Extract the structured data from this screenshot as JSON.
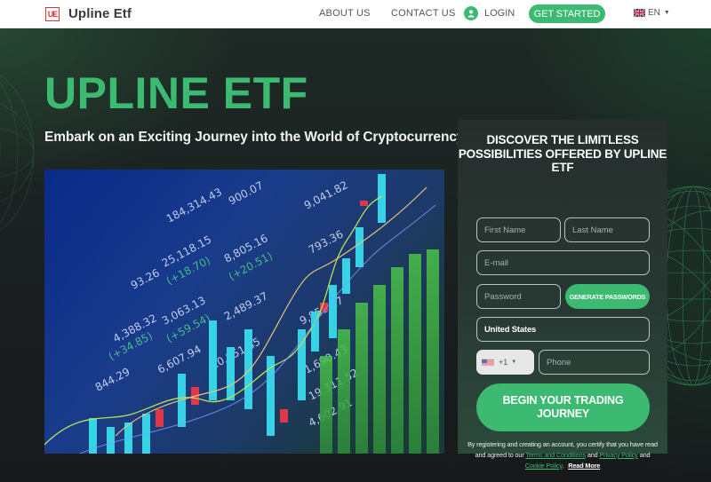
{
  "header": {
    "logo_mark": "UE",
    "logo_text": "Upline Etf",
    "nav": [
      {
        "label": "ABOUT US"
      },
      {
        "label": "CONTACT US"
      }
    ],
    "login_label": "LOGIN",
    "get_started_label": "GET STARTED",
    "language": "EN"
  },
  "hero": {
    "title": "UPLINE ETF",
    "subtitle": "Embark on an Exciting Journey into the World of Cryptocurrency",
    "image_alt": "Stock market ticker board with candlestick chart",
    "image_ticker_values": [
      "184,314.43",
      "900.07",
      "25,118.15",
      "8,805.16",
      "(+20.51)",
      "(+18.70)",
      "3,063.13",
      "(+59.54)",
      "2,489.37",
      "4,388.32",
      "(+34.85)",
      "6,607.94",
      "844.29",
      "10,951.65",
      "9,851.27",
      "1,690.43",
      "19,311.52",
      "4,602.91",
      "9,041.82",
      "793.36",
      "93.26"
    ]
  },
  "form": {
    "title": "DISCOVER THE LIMITLESS POSSIBILITIES OFFERED BY UPLINE ETF",
    "first_name_placeholder": "First Name",
    "last_name_placeholder": "Last Name",
    "email_placeholder": "E-mail",
    "password_placeholder": "Password",
    "generate_label": "GENERATE PASSWORDS",
    "country_value": "United States",
    "phone_code": "+1",
    "phone_placeholder": "Phone",
    "submit_label": "BEGIN YOUR TRADING JOURNEY",
    "disclaimer": {
      "text_1": "By registering and creating an account, you certify that you have read and agreed to our",
      "terms_link": "Terms and Conditions",
      "text_2": "and",
      "privacy_link": "Privacy Policy",
      "text_3": "and",
      "cookie_link": "Cookie Policy",
      "text_4": ".",
      "read_more": "Read More"
    }
  },
  "colors": {
    "accent": "#3dba72",
    "logo_red": "#d93535",
    "header_bg": "#ffffff",
    "hero_bg": "#1a1e20"
  }
}
